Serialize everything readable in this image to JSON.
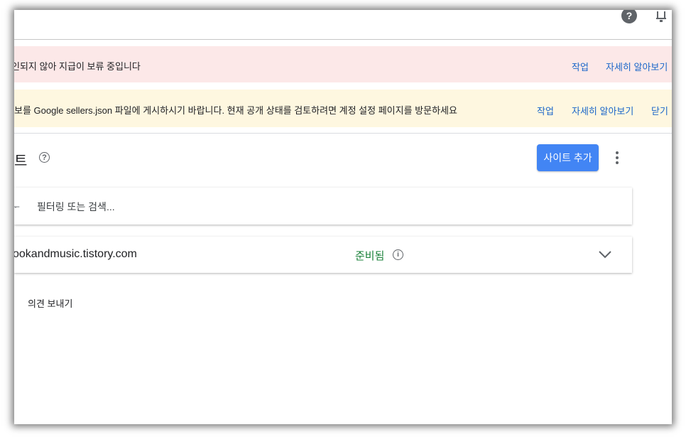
{
  "topbar": {
    "help_icon": "help-circle-icon",
    "help_glyph": "?",
    "bell_icon": "notification-bell-icon"
  },
  "banners": {
    "error": {
      "message": "인되지 않아 지급이 보류 중입니다",
      "action_label": "작업",
      "learn_more_label": "자세히 알아보기",
      "color": "#fce8e8"
    },
    "warning": {
      "message": "보를 Google sellers.json 파일에 게시하시기 바랍니다. 현재 공개 상태를 검토하려면 계정 설정 페이지를 방문하세요",
      "action_label": "작업",
      "learn_more_label": "자세히 알아보기",
      "dismiss_label": "닫기",
      "color": "#fef7e0"
    }
  },
  "header": {
    "title": "트",
    "help_glyph": "?",
    "add_site_label": "사이트 추가",
    "more_icon": "more-vertical-icon",
    "accent": "#4285f4"
  },
  "search": {
    "filter_icon": "filter-icon",
    "filter_glyph": "ᅮ",
    "placeholder": "필터링 또는 검색..."
  },
  "sites": [
    {
      "name": "ookandmusic.tistory.com",
      "status": "준비됨",
      "status_color": "#188038",
      "info_glyph": "i",
      "expand_icon": "chevron-down-icon"
    }
  ],
  "feedback": {
    "label": "의견 보내기"
  }
}
